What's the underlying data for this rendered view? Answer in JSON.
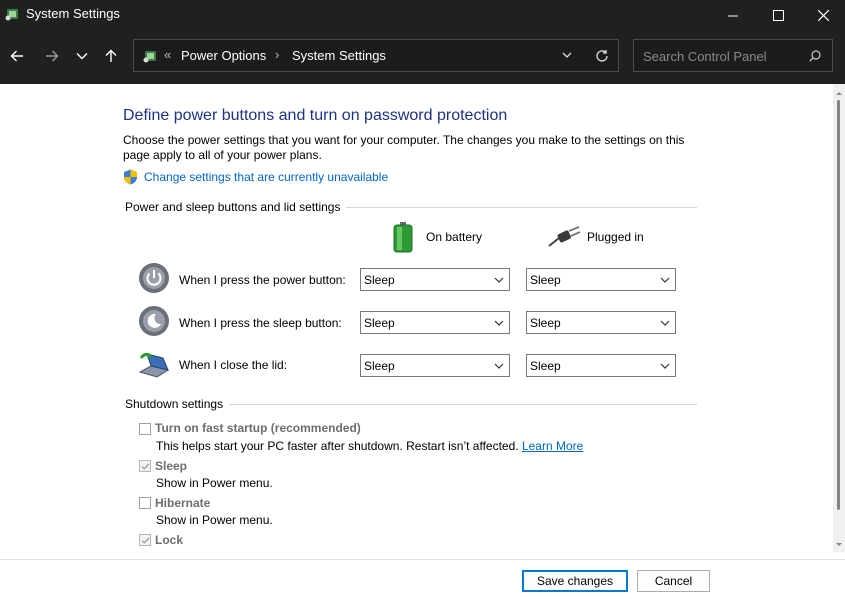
{
  "window": {
    "title": "System Settings",
    "controls": {
      "minimize": "minimize-icon",
      "maximize": "maximize-icon",
      "close": "close-icon"
    }
  },
  "nav": {
    "back": "back-arrow-icon",
    "forward": "forward-arrow-icon",
    "recent": "chevron-down-icon",
    "up": "up-arrow-icon",
    "breadcrumb_overflow": "«",
    "breadcrumb": [
      "Power Options",
      "System Settings"
    ],
    "search_placeholder": "Search Control Panel"
  },
  "main": {
    "heading": "Define power buttons and turn on password protection",
    "description": "Choose the power settings that you want for your computer. The changes you make to the settings on this page apply to all of your power plans.",
    "change_link": "Change settings that are currently unavailable",
    "power_section": {
      "label": "Power and sleep buttons and lid settings",
      "columns": {
        "battery": "On battery",
        "plugged": "Plugged in"
      },
      "rows": [
        {
          "label": "When I press the power button:",
          "battery": "Sleep",
          "plugged": "Sleep"
        },
        {
          "label": "When I press the sleep button:",
          "battery": "Sleep",
          "plugged": "Sleep"
        },
        {
          "label": "When I close the lid:",
          "battery": "Sleep",
          "plugged": "Sleep"
        }
      ]
    },
    "shutdown_section": {
      "label": "Shutdown settings",
      "items": [
        {
          "label": "Turn on fast startup (recommended)",
          "checked": false,
          "desc": "This helps start your PC faster after shutdown. Restart isn’t affected.",
          "link": "Learn More"
        },
        {
          "label": "Sleep",
          "checked": true,
          "desc": "Show in Power menu."
        },
        {
          "label": "Hibernate",
          "checked": false,
          "desc": "Show in Power menu."
        },
        {
          "label": "Lock",
          "checked": true
        }
      ]
    }
  },
  "footer": {
    "save": "Save changes",
    "cancel": "Cancel"
  },
  "colors": {
    "titlebar": "#202020",
    "heading": "#1e3287",
    "link": "#0066cc",
    "accent": "#0078d4"
  }
}
